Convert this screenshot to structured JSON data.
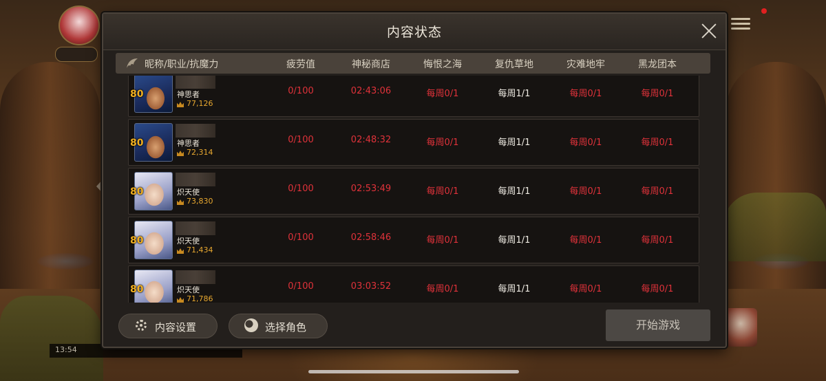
{
  "dialog": {
    "title": "内容状态",
    "close_label": ""
  },
  "columns": {
    "name": "昵称/职业/抗魔力",
    "fatigue": "疲劳值",
    "shop": "神秘商店",
    "regret_sea": "悔恨之海",
    "revenge_grass": "复仇草地",
    "disaster_prison": "灾难地牢",
    "black_dragon": "黑龙团本"
  },
  "rows": [
    {
      "level": "80",
      "job": "神思者",
      "power": "77,126",
      "portrait": "blue",
      "fatigue": "0/100",
      "shop": "02:43:06",
      "regret_sea": "每周0/1",
      "revenge_grass": "每周1/1",
      "disaster_prison": "每周0/1",
      "black_dragon": "每周0/1"
    },
    {
      "level": "80",
      "job": "神思者",
      "power": "72,314",
      "portrait": "blue",
      "fatigue": "0/100",
      "shop": "02:48:32",
      "regret_sea": "每周0/1",
      "revenge_grass": "每周1/1",
      "disaster_prison": "每周0/1",
      "black_dragon": "每周0/1"
    },
    {
      "level": "80",
      "job": "炽天使",
      "power": "73,830",
      "portrait": "white",
      "fatigue": "0/100",
      "shop": "02:53:49",
      "regret_sea": "每周0/1",
      "revenge_grass": "每周1/1",
      "disaster_prison": "每周0/1",
      "black_dragon": "每周0/1"
    },
    {
      "level": "80",
      "job": "炽天使",
      "power": "71,434",
      "portrait": "white",
      "fatigue": "0/100",
      "shop": "02:58:46",
      "regret_sea": "每周0/1",
      "revenge_grass": "每周1/1",
      "disaster_prison": "每周0/1",
      "black_dragon": "每周0/1"
    },
    {
      "level": "80",
      "job": "炽天使",
      "power": "71,786",
      "portrait": "white",
      "fatigue": "0/100",
      "shop": "03:03:52",
      "regret_sea": "每周0/1",
      "revenge_grass": "每周1/1",
      "disaster_prison": "每周0/1",
      "black_dragon": "每周0/1"
    }
  ],
  "footer": {
    "content_settings": "内容设置",
    "select_character": "选择角色",
    "start_game": "开始游戏"
  },
  "status_bar": {
    "time": "13:54"
  },
  "colors": {
    "accent_red": "#e0323a",
    "power_gold": "#e8a830",
    "level_gold": "#f2b020"
  },
  "icons": {
    "close": "close-icon",
    "header": "wing-icon",
    "settings": "gear-icon",
    "character": "character-icon",
    "power": "crown-icon"
  }
}
